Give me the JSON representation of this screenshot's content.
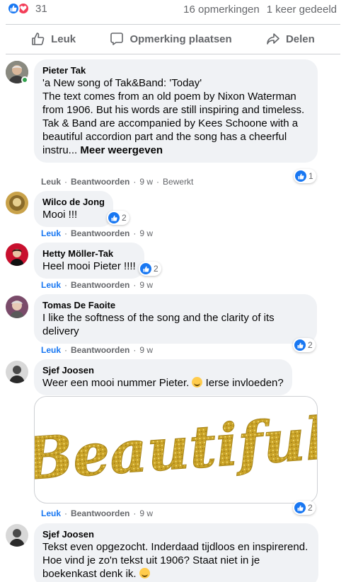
{
  "top": {
    "reaction_count": "31",
    "comments": "16 opmerkingen",
    "shares": "1 keer gedeeld"
  },
  "actions": {
    "like": "Leuk",
    "comment": "Opmerking plaatsen",
    "share": "Delen"
  },
  "comments": [
    {
      "author": "Pieter Tak",
      "text": "'a New song of Tak&Band: 'Today'\nThe text comes from an old poem by Nixon Waterman from 1906. But his words are still inspiring and timeless.\nTak & Band are accompanied by Kees Schoone with a beautiful accordion part and the song has a cheerful instru... ",
      "more": "Meer weergeven",
      "like": "Leuk",
      "reply": "Beantwoorden",
      "time": "9 w",
      "edited": "Bewerkt",
      "reactions": "1"
    },
    {
      "author": "Wilco de Jong",
      "text": "Mooi !!!",
      "like": "Leuk",
      "reply": "Beantwoorden",
      "time": "9 w",
      "reactions": "2"
    },
    {
      "author": "Hetty Möller-Tak",
      "text": "Heel mooi Pieter !!!!",
      "like": "Leuk",
      "reply": "Beantwoorden",
      "time": "9 w",
      "reactions": "2"
    },
    {
      "author": "Tomas De Faoite",
      "text": "I like the softness of the song and the clarity of its delivery",
      "like": "Leuk",
      "reply": "Beantwoorden",
      "time": "9 w",
      "reactions": "2"
    },
    {
      "author": "Sjef Joosen",
      "text_before": "Weer een mooi nummer Pieter. ",
      "text_after": " Ierse invloeden?",
      "image_text": "Beautiful",
      "like": "Leuk",
      "reply": "Beantwoorden",
      "time": "9 w",
      "reactions": "2"
    },
    {
      "author": "Sjef Joosen",
      "text": "Tekst even opgezocht. Inderdaad tijdloos en inspirerend. Hoe vind je zo'n tekst uit 1906? Staat niet in je boekenkast denk ik. "
    }
  ],
  "sep": "·",
  "colors": {
    "accent": "#1877f2",
    "bubble": "#f0f2f5",
    "muted": "#65676b"
  }
}
